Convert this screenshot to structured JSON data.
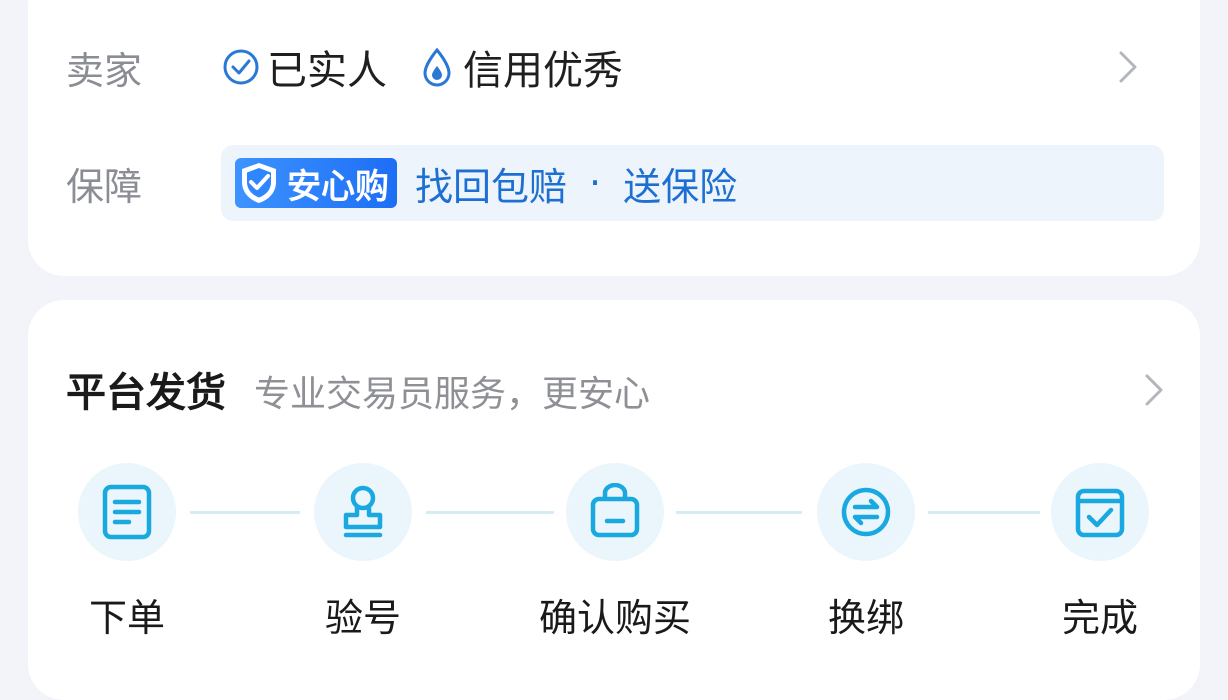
{
  "seller": {
    "label": "卖家",
    "tags": [
      {
        "text": "已实人",
        "icon": "check-circle-icon"
      },
      {
        "text": "信用优秀",
        "icon": "drop-icon"
      }
    ]
  },
  "guarantee": {
    "label": "保障",
    "badge": "安心购",
    "text1": "找回包赔",
    "separator": "·",
    "text2": "送保险"
  },
  "delivery": {
    "title": "平台发货",
    "subtitle": "专业交易员服务，更安心",
    "steps": [
      {
        "label": "下单",
        "icon": "order-document-icon"
      },
      {
        "label": "验号",
        "icon": "stamp-icon"
      },
      {
        "label": "确认购买",
        "icon": "shopping-bag-icon"
      },
      {
        "label": "换绑",
        "icon": "exchange-icon"
      },
      {
        "label": "完成",
        "icon": "calendar-check-icon"
      }
    ]
  },
  "colors": {
    "accent": "#1d6fd2",
    "step_icon": "#19a8e0",
    "badge_bg": "#2f86ff",
    "page_bg": "#f2f4f9"
  }
}
